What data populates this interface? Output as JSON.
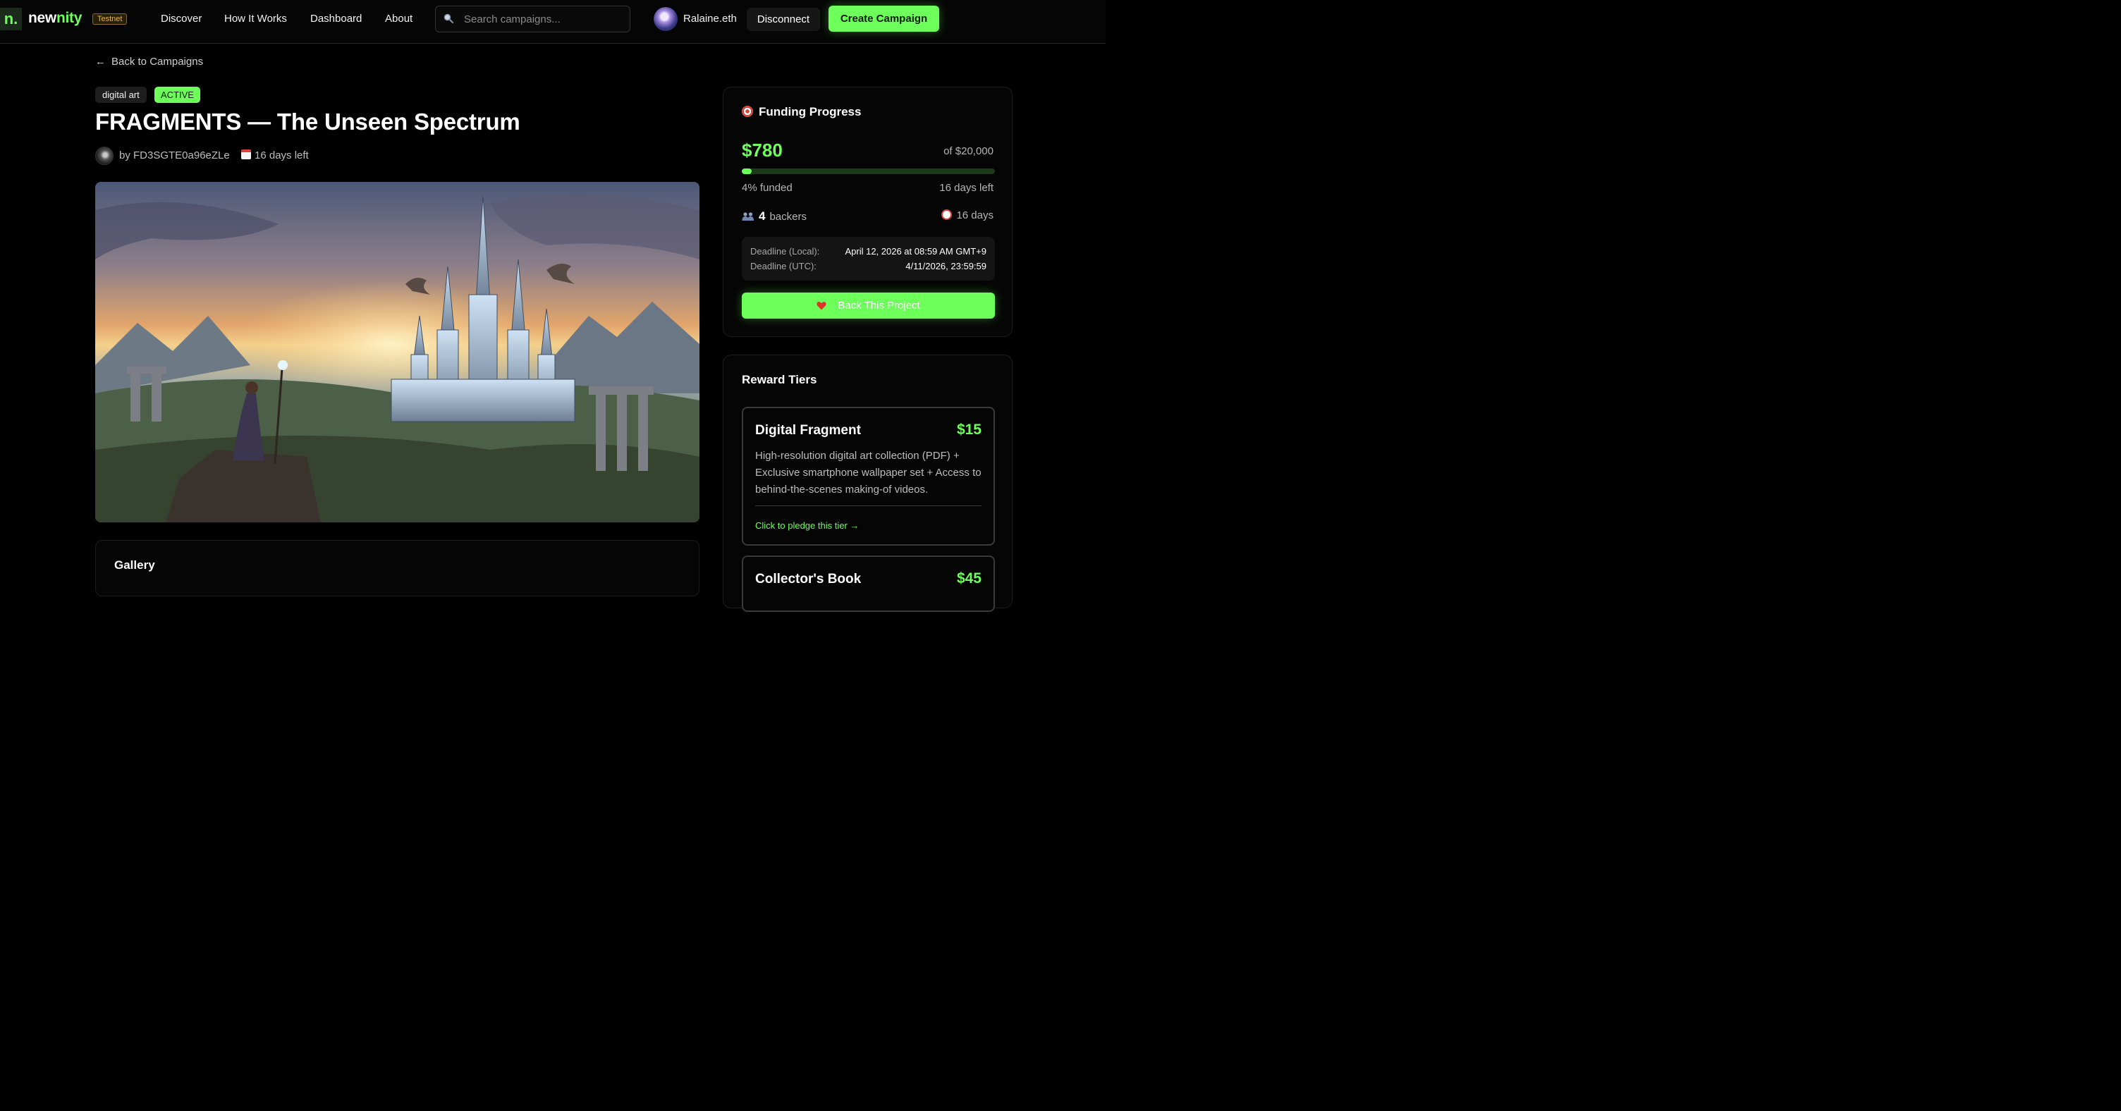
{
  "nav": {
    "logo_mark": "n.",
    "logo_new": "new",
    "logo_nity": "nity",
    "badge": "Testnet",
    "links": [
      "Discover",
      "How It Works",
      "Dashboard",
      "About"
    ],
    "search_placeholder": "Search campaigns...",
    "username": "Ralaine.eth",
    "disconnect_label": "Disconnect",
    "create_label": "Create Campaign"
  },
  "campaign": {
    "back_label": "Back to Campaigns",
    "category": "digital art",
    "status": "ACTIVE",
    "title": "FRAGMENTS — The Unseen Spectrum",
    "creator": "by FD3SGTE0a96eZLe",
    "days_left": "16 days left",
    "gallery_title": "Gallery"
  },
  "funding": {
    "heading": "Funding Progress",
    "raised": "$780",
    "goal": "of $20,000",
    "progress_fraction": 0.04,
    "percent_funded": "4% funded",
    "days_left": "16 days left",
    "backers_count": "4",
    "backers_label": "backers",
    "duration": "16 days",
    "deadline_local_label": "Deadline (Local):",
    "deadline_local_value": "April 12, 2026 at 08:59 AM GMT+9",
    "deadline_utc_label": "Deadline (UTC):",
    "deadline_utc_value": "4/11/2026, 23:59:59",
    "back_button_label": "Back This Project"
  },
  "rewards": {
    "heading": "Reward Tiers",
    "tiers": [
      {
        "name": "Digital Fragment",
        "price": "$15",
        "description": "High-resolution digital art collection (PDF) + Exclusive smartphone wallpaper set + Access to behind-the-scenes making-of videos.",
        "cta": "Click to pledge this tier →"
      },
      {
        "name": "Collector's Book",
        "price": "$45"
      }
    ]
  },
  "colors": {
    "accent": "#6dff5a",
    "background": "#000000",
    "card": "#050505",
    "testnet": "#e7b54a"
  },
  "icons": [
    "search-icon",
    "arrow-left-icon",
    "calendar-icon",
    "target-icon",
    "people-icon",
    "alarm-clock-icon",
    "heart-icon"
  ]
}
